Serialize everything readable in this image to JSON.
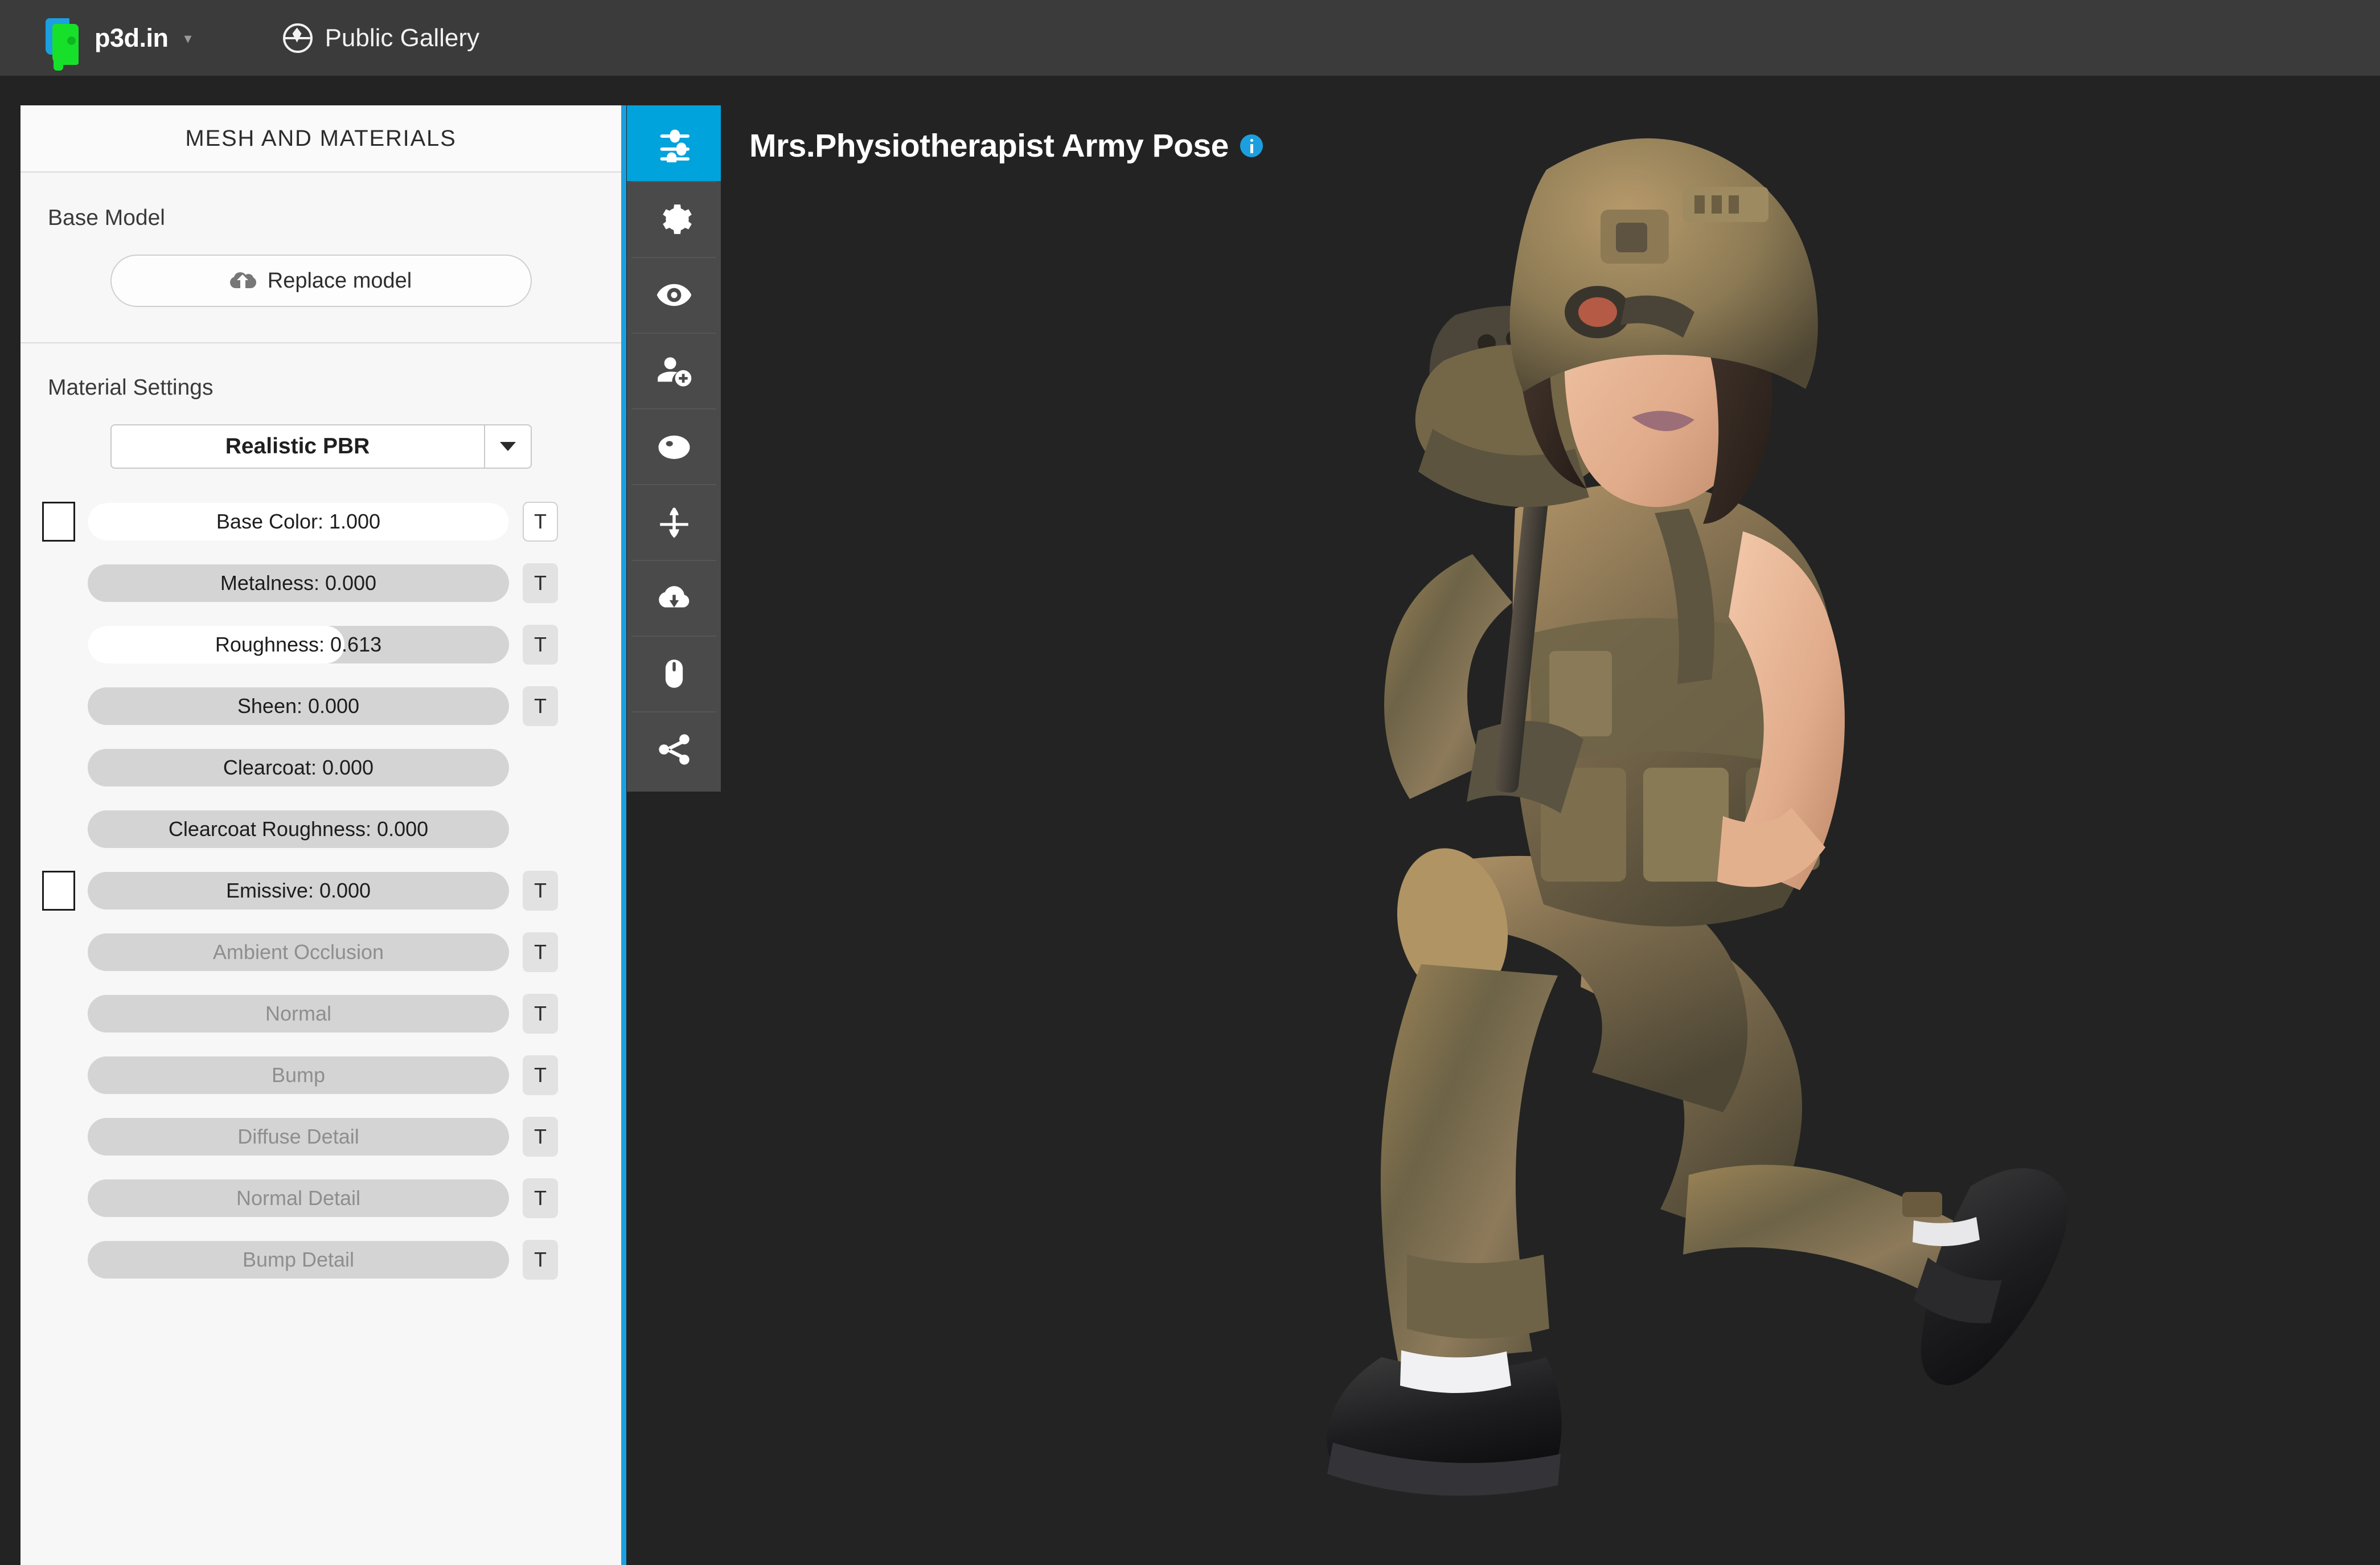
{
  "topbar": {
    "brand_label": "p3d.in",
    "brand_caret": "▾",
    "gallery_label": "Public Gallery",
    "logo_icon": "p3d-logo-icon",
    "globe_icon": "globe-icon"
  },
  "panel": {
    "title": "MESH AND MATERIALS",
    "base_model": {
      "label": "Base Model",
      "replace_button": "Replace model",
      "replace_icon": "cloud-upload-icon"
    },
    "material": {
      "label": "Material Settings",
      "shader_selected": "Realistic PBR",
      "shader_options": [
        "Realistic PBR"
      ],
      "dropdown_icon": "chevron-down-icon"
    },
    "texture_button_label": "T",
    "sliders": [
      {
        "label": "Base Color: 1.000",
        "name": "base-color",
        "value": 1.0,
        "fill_pct": 100,
        "swatch": true,
        "swatch_color": "#ffffff",
        "tbtn": "white",
        "disabled": false
      },
      {
        "label": "Metalness: 0.000",
        "name": "metalness",
        "value": 0.0,
        "fill_pct": 0,
        "swatch": false,
        "swatch_color": "",
        "tbtn": "normal",
        "disabled": false
      },
      {
        "label": "Roughness: 0.613",
        "name": "roughness",
        "value": 0.613,
        "fill_pct": 61,
        "swatch": false,
        "swatch_color": "",
        "tbtn": "normal",
        "disabled": false
      },
      {
        "label": "Sheen: 0.000",
        "name": "sheen",
        "value": 0.0,
        "fill_pct": 0,
        "swatch": false,
        "swatch_color": "",
        "tbtn": "normal",
        "disabled": false
      },
      {
        "label": "Clearcoat: 0.000",
        "name": "clearcoat",
        "value": 0.0,
        "fill_pct": 0,
        "swatch": false,
        "swatch_color": "",
        "tbtn": "hidden",
        "disabled": false
      },
      {
        "label": "Clearcoat Roughness: 0.000",
        "name": "clearcoat-roughness",
        "value": 0.0,
        "fill_pct": 0,
        "swatch": false,
        "swatch_color": "",
        "tbtn": "hidden",
        "disabled": false
      },
      {
        "label": "Emissive: 0.000",
        "name": "emissive",
        "value": 0.0,
        "fill_pct": 0,
        "swatch": true,
        "swatch_color": "#ffffff",
        "tbtn": "normal",
        "disabled": false
      },
      {
        "label": "Ambient Occlusion",
        "name": "ambient-occlusion",
        "value": null,
        "fill_pct": 0,
        "swatch": false,
        "swatch_color": "",
        "tbtn": "normal",
        "disabled": true
      },
      {
        "label": "Normal",
        "name": "normal",
        "value": null,
        "fill_pct": 0,
        "swatch": false,
        "swatch_color": "",
        "tbtn": "normal",
        "disabled": true
      },
      {
        "label": "Bump",
        "name": "bump",
        "value": null,
        "fill_pct": 0,
        "swatch": false,
        "swatch_color": "",
        "tbtn": "normal",
        "disabled": true
      },
      {
        "label": "Diffuse Detail",
        "name": "diffuse-detail",
        "value": null,
        "fill_pct": 0,
        "swatch": false,
        "swatch_color": "",
        "tbtn": "normal",
        "disabled": true
      },
      {
        "label": "Normal Detail",
        "name": "normal-detail",
        "value": null,
        "fill_pct": 0,
        "swatch": false,
        "swatch_color": "",
        "tbtn": "normal",
        "disabled": true
      },
      {
        "label": "Bump Detail",
        "name": "bump-detail",
        "value": null,
        "fill_pct": 0,
        "swatch": false,
        "swatch_color": "",
        "tbtn": "normal",
        "disabled": true
      }
    ]
  },
  "toolbar": {
    "active_index": 0,
    "active_color": "#00a3dc",
    "items": [
      {
        "icon": "sliders-icon",
        "name": "tool-mesh-and-materials"
      },
      {
        "icon": "gear-icon",
        "name": "tool-settings"
      },
      {
        "icon": "eye-icon",
        "name": "tool-visibility"
      },
      {
        "icon": "person-add-icon",
        "name": "tool-add-person"
      },
      {
        "icon": "sphere-icon",
        "name": "tool-environment"
      },
      {
        "icon": "anchor-icon",
        "name": "tool-anchor"
      },
      {
        "icon": "cloud-download-icon",
        "name": "tool-download"
      },
      {
        "icon": "mouse-icon",
        "name": "tool-controls"
      },
      {
        "icon": "share-icon",
        "name": "tool-share"
      }
    ]
  },
  "viewport": {
    "model_title": "Mrs.Physiotherapist Army Pose",
    "info_icon": "info-icon",
    "background_color": "#232323",
    "model_description": "3D scanned female soldier in camouflage uniform, kneeling firing pose with helmet, tactical vest and rifle"
  }
}
